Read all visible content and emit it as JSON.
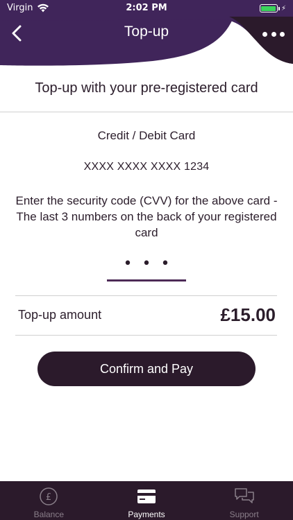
{
  "status_bar": {
    "carrier": "Virgin",
    "time": "2:02 PM"
  },
  "header": {
    "title": "Top-up",
    "back_icon": "chevron-left-icon",
    "more_icon": "more-horizontal-icon"
  },
  "content": {
    "subtitle": "Top-up with your pre-registered card",
    "card_type": "Credit / Debit Card",
    "card_number": "XXXX XXXX XXXX 1234",
    "instructions": "Enter the security code (CVV) for the above card - The last 3 numbers on the back of your registered card",
    "cvv_value": "•••",
    "amount_label": "Top-up amount",
    "amount_value": "£15.00",
    "confirm_label": "Confirm and Pay"
  },
  "tabs": [
    {
      "label": "Balance",
      "icon": "pound-coin-icon",
      "active": false
    },
    {
      "label": "Payments",
      "icon": "credit-card-icon",
      "active": true
    },
    {
      "label": "Support",
      "icon": "chat-bubbles-icon",
      "active": false
    }
  ],
  "colors": {
    "header_purple": "#3f2559",
    "dark_plum": "#2b1a2b",
    "accent_purple": "#4d2a57",
    "battery_green": "#3ad35b"
  }
}
